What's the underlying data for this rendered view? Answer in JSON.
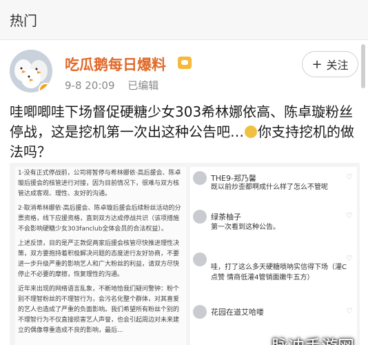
{
  "header": {
    "section_title": "热门"
  },
  "post": {
    "username": "吃瓜鹅每日爆料",
    "date": "9-8 20:09",
    "edited": "已编辑",
    "follow_label": "关注",
    "text_before_emoji": "哇唧唧哇下场督促硬糖少女303希林娜依高、陈卓璇粉丝停战，这是挖机第一次出这种公告吧…",
    "text_after_emoji": "你支持挖机的做法吗？"
  },
  "image": {
    "doc_paragraphs": [
      "1·没有正式停战前，公司将暂停与希林娜依·高后援会、陈卓璇后援会的核管进行对接，因为目前情况下，很难与双方核管达成客观、理性、友好的沟通。",
      "2·取消希林娜依·高后援会、陈卓璇后援会后续粉丝活动的分票资格，线下应援资格，直到双方达成停战共识（该项措施不会影响硬糖少女303fanclub全体会员的合法权益）。",
      "上述反馈，目的是严正敦促两家后援会核管尽快推进理性决策，双方要抱持着积极解决问题的态度进行友好协商，不要进一步升级严重的影响艺人和广大粉丝的利益，请双方尽快停止不必要的摩擦，恢复理性的沟通。",
      "近年来出现的网络语言乱象，不断地恰我们疑问警钟：粉个别不理智粉丝的不理智行为，会污名化整个群体，对其喜爱的艺人也造成了严重的负面影响。我们希望所有粉丝个别的不理智行为不仅直接损害艺人声誉，也会引起周边对未来建立的偶像尊重造成不良的影响，最后..."
    ],
    "comments": [
      {
        "name": "THE9-郑乃馨",
        "time": "",
        "text": "既以前炒歪都啊成什么样了怎么不管呢"
      },
      {
        "name": "绿茶柚子",
        "time": "",
        "text": "第一次看到这种公告。"
      },
      {
        "name": "",
        "time": "",
        "text": "哇，打了这么多天硬糖唢呐实信得下场（灌C点赞 情商低灌4管销面嫩牛五方）"
      },
      {
        "name": "花园在道艾哈喽",
        "time": "",
        "text": ""
      }
    ],
    "watermark": "脉冲手游网"
  },
  "colors": {
    "username": "#e06a2a",
    "vip_badge": "#f6b93b",
    "verified_badge": "#f2a516"
  },
  "icons": [
    "plus-icon",
    "vip-icon",
    "verified-badge-icon",
    "emoji-icon",
    "heart-icon"
  ]
}
